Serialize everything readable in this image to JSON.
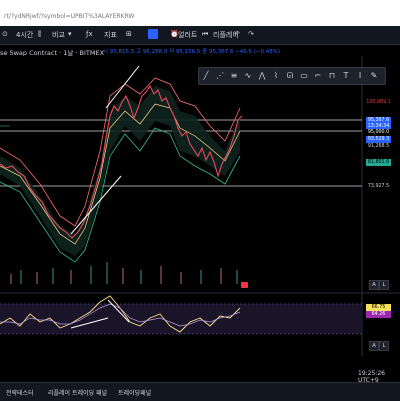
{
  "browser": {
    "url": "rt/?ydNRjwf/?symbol=UPBIT%3ALAYERKRW"
  },
  "toolbar": {
    "interval": "4시간",
    "compare": "비교",
    "indicators": "지표",
    "alert": "얼러트",
    "replay": "리플레이"
  },
  "chart": {
    "title": "se Swap Contract · 1날 · BITMEX",
    "ohlc": "시 95,815.5 고 96,288.0 저 95,156.5 종 95,367.6 −46.5 (−0.48%)",
    "left_tick": ".0"
  },
  "price_labels": [
    {
      "text": "100,989.1",
      "color": "#f23645",
      "bg": "#000000"
    },
    {
      "text": "95,367.6",
      "color": "#ffffff",
      "bg": "#2962ff"
    },
    {
      "text": "13:34:34",
      "color": "#ffffff",
      "bg": "#2962ff"
    },
    {
      "text": "95,000.0",
      "color": "#ffffff",
      "bg": "#000000"
    },
    {
      "text": "93,529.3",
      "color": "#ffffff",
      "bg": "#2962ff"
    },
    {
      "text": "91,268.5",
      "color": "#d1d4dc",
      "bg": "#000000"
    },
    {
      "text": "81,801.6",
      "color": "#000000",
      "bg": "#22ab94"
    },
    {
      "text": "73,927.5",
      "color": "#d1d4dc",
      "bg": "#000000"
    }
  ],
  "osc_labels": [
    {
      "text": "66.75",
      "color": "#000000",
      "bg": "#f5e05a"
    },
    {
      "text": "64.26",
      "color": "#ffffff",
      "bg": "#9c27b0"
    }
  ],
  "scale_buttons": {
    "a": "A",
    "l": "L"
  },
  "footer": {
    "clock": "19:25:26 UTC+9",
    "tabs": [
      "전략테스터",
      "리플레이 트레이딩 패널",
      "트레이딩패널"
    ]
  }
}
